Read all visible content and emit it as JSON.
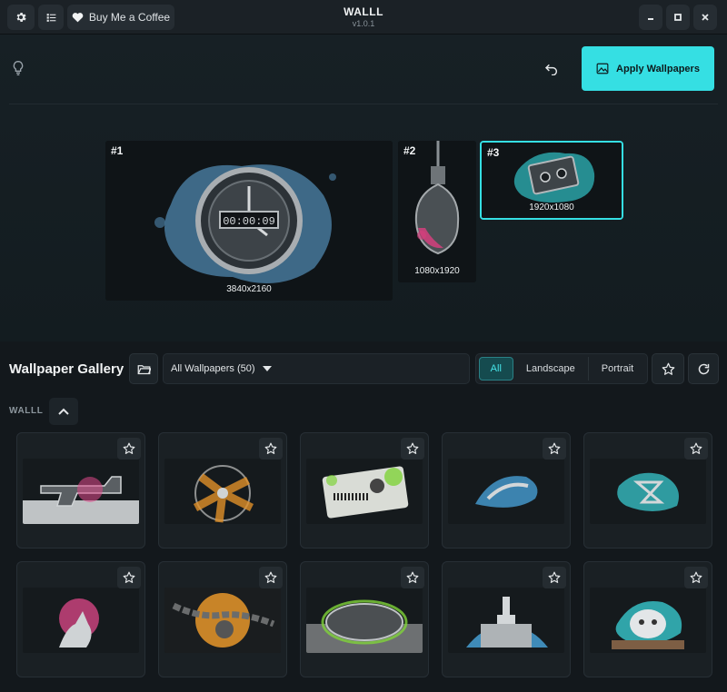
{
  "titlebar": {
    "app_title": "WALLL",
    "version": "v1.0.1",
    "coffee_label": "Buy Me a Coffee",
    "settings_icon": "gear-icon",
    "list_icon": "list-icon",
    "heart_icon": "heart-icon",
    "minimize_icon": "minimize-icon",
    "maximize_icon": "maximize-icon",
    "close_icon": "close-icon"
  },
  "toolbar": {
    "apply_label": "Apply Wallpapers",
    "undo_icon": "undo-icon",
    "bulb_icon": "lightbulb-icon",
    "image_icon": "image-icon"
  },
  "monitors": [
    {
      "number": "#1",
      "resolution": "3840x2160",
      "selected": false,
      "theme": "clock"
    },
    {
      "number": "#2",
      "resolution": "1080x1920",
      "selected": false,
      "theme": "bulb"
    },
    {
      "number": "#3",
      "resolution": "1920x1080",
      "selected": true,
      "theme": "cassette"
    }
  ],
  "gallery": {
    "title": "Wallpaper Gallery",
    "dropdown_value": "All Wallpapers (50)",
    "filters": [
      "All",
      "Landscape",
      "Portrait"
    ],
    "active_filter": "All",
    "section_label": "WALLL",
    "cards": [
      {
        "theme": "gun",
        "accent": "#e0488a"
      },
      {
        "theme": "fan",
        "accent": "#e0902a"
      },
      {
        "theme": "ticket",
        "accent": "#7fd33a"
      },
      {
        "theme": "whale",
        "accent": "#4aa7e0"
      },
      {
        "theme": "hourglass",
        "accent": "#3ad3d8"
      },
      {
        "theme": "hand",
        "accent": "#e0488a"
      },
      {
        "theme": "chain",
        "accent": "#e8962a"
      },
      {
        "theme": "manhole",
        "accent": "#7fd33a"
      },
      {
        "theme": "palace",
        "accent": "#4aa7e0"
      },
      {
        "theme": "mask",
        "accent": "#3ad3d8"
      }
    ]
  },
  "colors": {
    "accent": "#35dfe3",
    "background": "#13181c"
  }
}
